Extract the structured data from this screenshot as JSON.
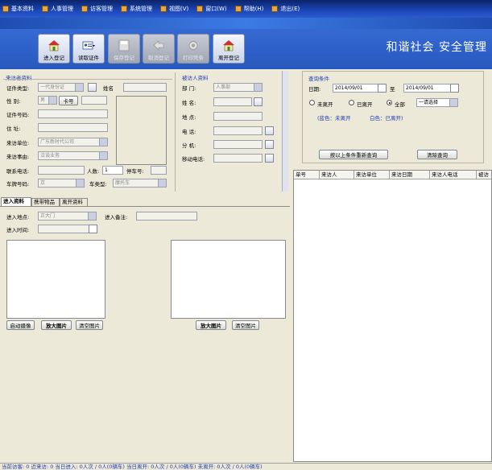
{
  "menu": [
    "基本资料",
    "人事管理",
    "访客管理",
    "系统管理",
    "视图(V)",
    "窗口(W)",
    "帮助(H)",
    "退出(E)"
  ],
  "toolbar": {
    "b1": "进入登记",
    "b2": "读取证件",
    "b3": "保存登记",
    "b4": "取消登记",
    "b5": "打印凭条",
    "b6": "离开登记"
  },
  "slogan": "和谐社会  安全管理",
  "visitor": {
    "title": "来访者资料",
    "id_type_label": "证件类型:",
    "id_type_value": "一代身份证",
    "name_label": "姓名",
    "sex_label": "性    别:",
    "sex_value": "男",
    "card_no_label": "卡号",
    "id_no_label": "证件号码:",
    "address_label": "住    址:",
    "unit_label": "来访单位:",
    "unit_value": "广东新时代公司",
    "reason_label": "来访事由:",
    "reason_value": "洽谈业务",
    "phone_label": "联系电话:",
    "people_label": "人数:",
    "people_value": "1",
    "parking_label": "停车号:",
    "plate_label": "车牌号码:",
    "plate_value": "京",
    "car_type_label": "车类型:",
    "car_type_value": "摩托车"
  },
  "host": {
    "title": "被访人资料",
    "dept_label": "部    门:",
    "dept_value": "人事部",
    "name_label": "姓    名:",
    "place_label": "地    点:",
    "tel_label": "电    话:",
    "ext_label": "分    机:",
    "mobile_label": "移动电话:"
  },
  "tabs": [
    "进入资料",
    "携带物品",
    "离开资料"
  ],
  "entry": {
    "spot_label": "进入地点:",
    "spot_value": "正大门",
    "note_label": "进入备注:",
    "time_label": "进入时间:",
    "btn_camera": "启动摄像",
    "btn_zoom1": "放大图片",
    "btn_clear1": "清空图片",
    "btn_zoom2": "放大图片",
    "btn_clear2": "清空图片"
  },
  "query": {
    "title": "查询条件",
    "date_label": "日期:",
    "date_from": "2014/09/01",
    "to_label": "至",
    "date_to": "2014/09/01",
    "r1": "未离开",
    "r2": "已离开",
    "r3": "全部",
    "select_value": "一请选择",
    "legend_blue": "(蓝色：未离开",
    "legend_white": "白色：已离开)",
    "btn_requery": "按以上条件重新查询",
    "btn_clear": "清除查询"
  },
  "grid": {
    "headers": [
      "单号",
      "来访人",
      "来访单位",
      "来访日期",
      "来访人电话",
      "被访"
    ]
  },
  "status": "当前访客: 0 近来访: 0   当日进入: 0人次 / 0人(0辆车)   当日离开: 0人次 / 0人(0辆车)   未离开: 0人次 / 0人(0辆车)"
}
